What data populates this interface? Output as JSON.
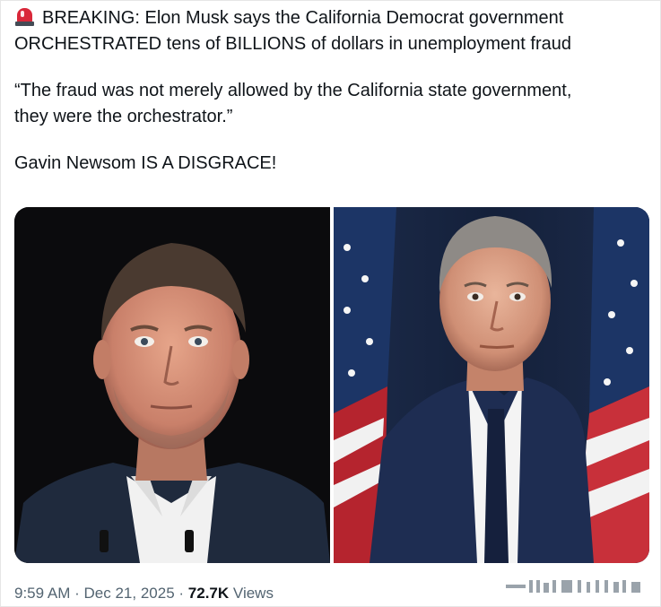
{
  "tweet": {
    "headline_icon": "police-siren-emoji",
    "lines": [
      "BREAKING: Elon Musk says the California Democrat government",
      "ORCHESTRATED tens of BILLIONS of dollars in unemployment fraud",
      "“The fraud was not merely allowed by the California state government,",
      "they were the orchestrator.”",
      "Gavin Newsom IS A DISGRACE!"
    ]
  },
  "media": {
    "left_photo": "portrait-elon-musk",
    "right_photo": "portrait-gavin-newsom-with-flags"
  },
  "meta": {
    "time": "9:59 AM",
    "separator": "·",
    "date": "Dec 21, 2025",
    "views_count": "72.7K",
    "views_label": "Views"
  },
  "colors": {
    "text": "#0f1419",
    "secondary": "#536471",
    "siren_red": "#d9283a"
  }
}
